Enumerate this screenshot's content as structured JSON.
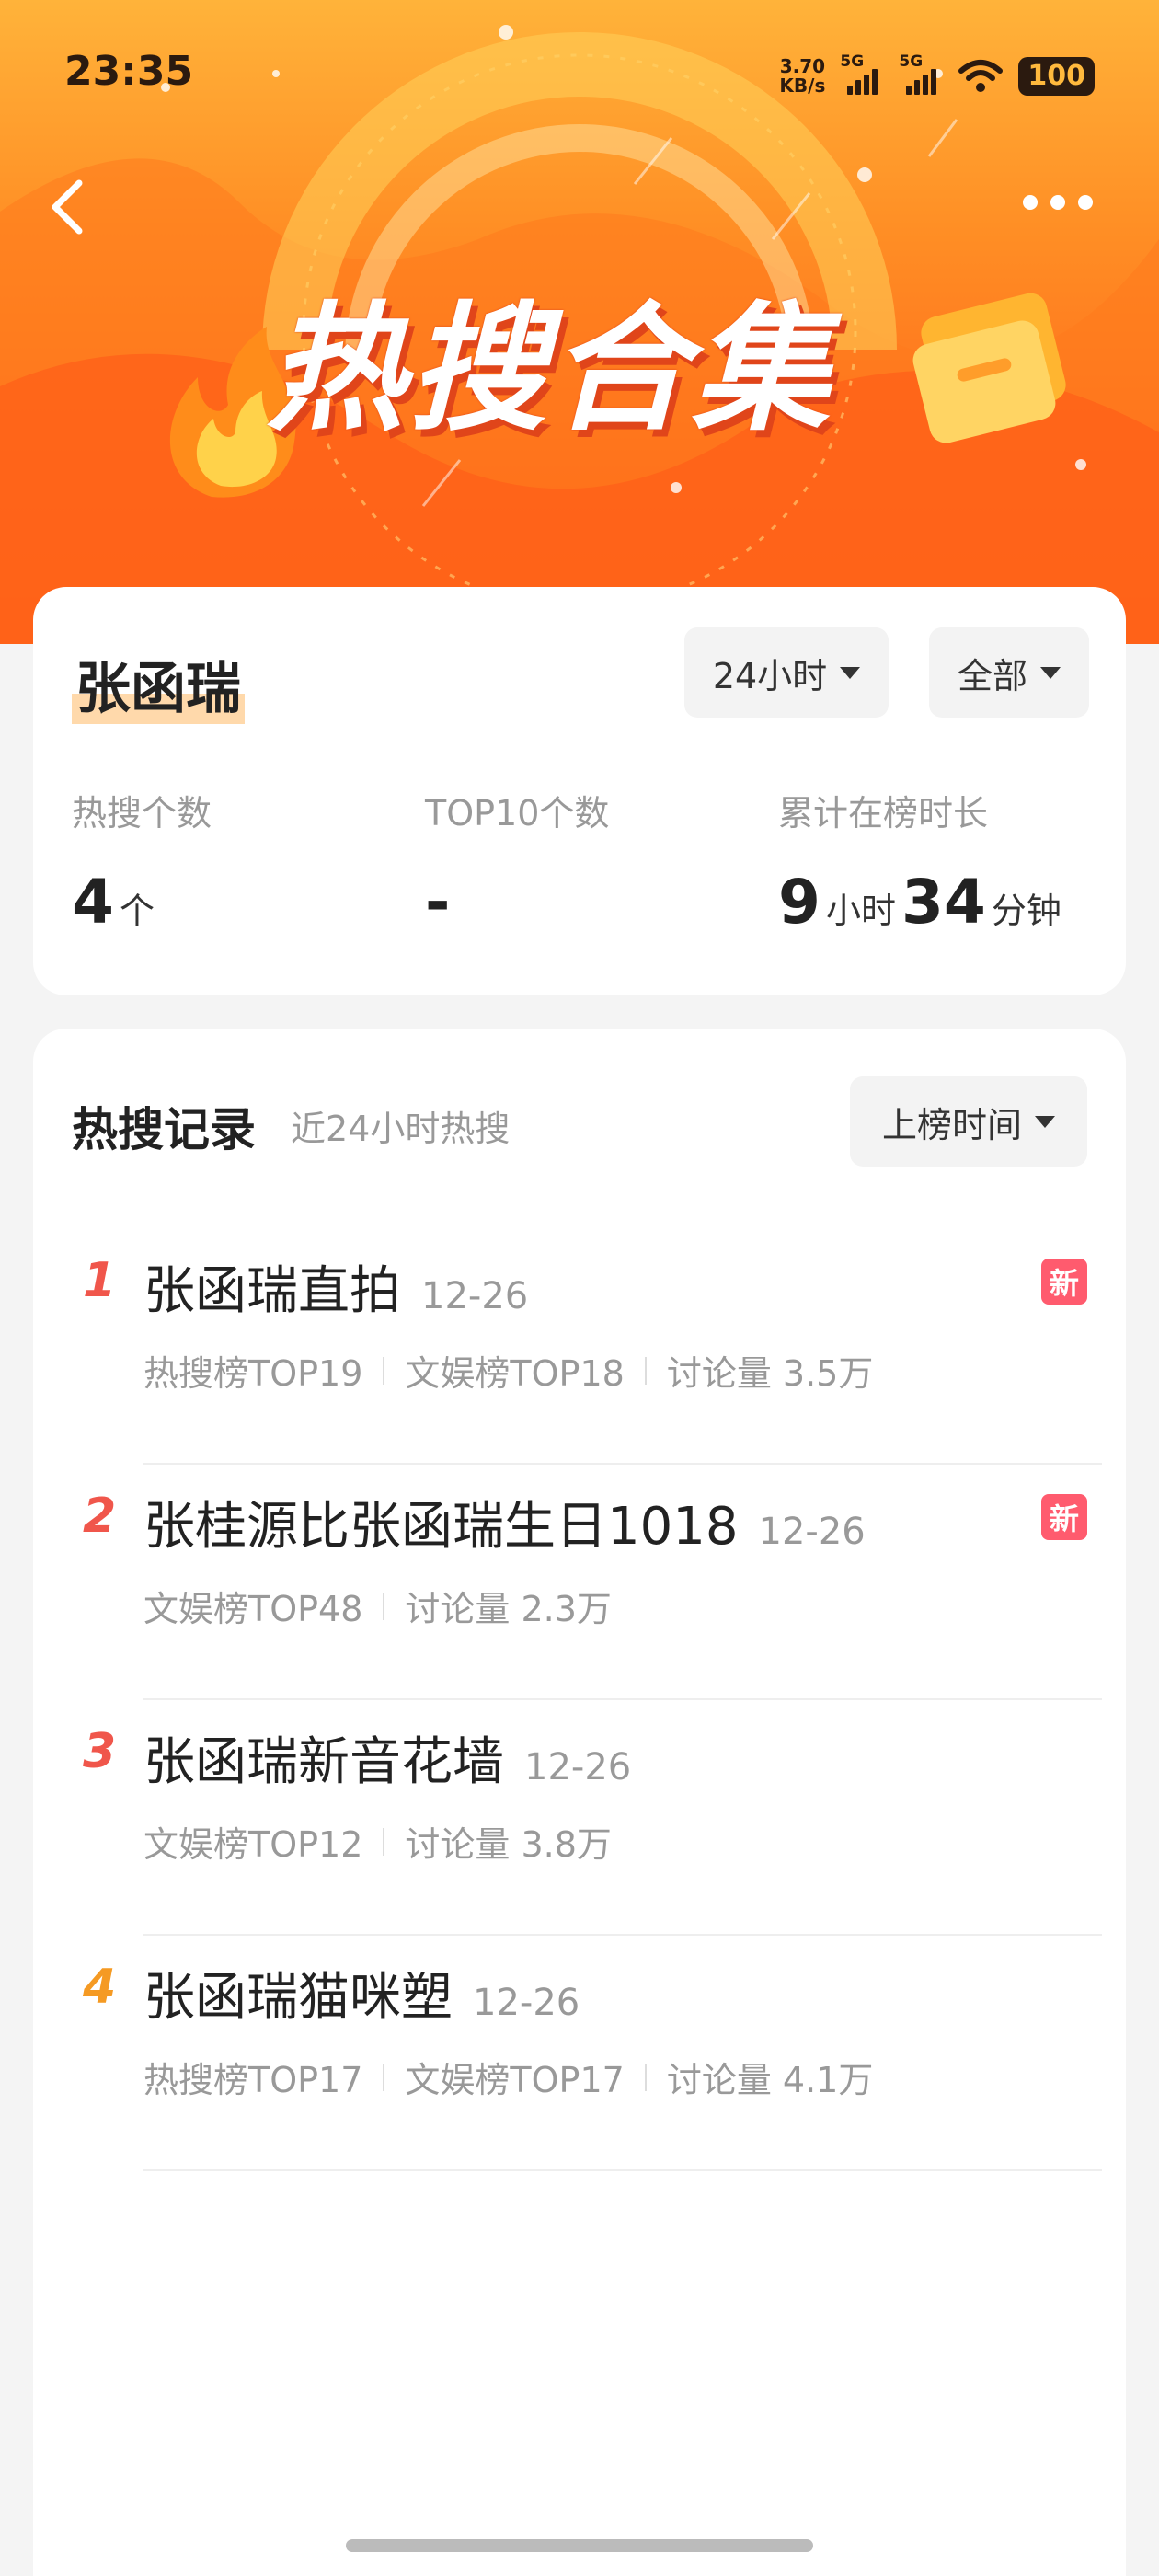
{
  "status_bar": {
    "time": "23:35",
    "net_speed_value": "3.70",
    "net_speed_unit": "KB/s",
    "signal1_label": "5G",
    "signal2_label": "5G",
    "battery": "100"
  },
  "header": {
    "banner_title": "热搜合集",
    "back_icon": "chevron-left-icon",
    "more_icon": "more-dots-icon",
    "colors": {
      "banner_top": "#ffb33a",
      "banner_bottom": "#ff5a17"
    }
  },
  "summary": {
    "topic": "张函瑞",
    "filter_time": "24小时",
    "filter_category": "全部",
    "stats": [
      {
        "label": "热搜个数",
        "value": "4",
        "unit": "个"
      },
      {
        "label": "TOP10个数",
        "value": "-"
      },
      {
        "label": "累计在榜时长",
        "hours": "9",
        "hours_unit": "小时",
        "minutes": "34",
        "minutes_unit": "分钟"
      }
    ]
  },
  "records": {
    "title": "热搜记录",
    "subtitle": "近24小时热搜",
    "sort_label": "上榜时间",
    "items": [
      {
        "rank": "1",
        "title": "张函瑞直拍",
        "date": "12-26",
        "meta": [
          "热搜榜TOP19",
          "文娱榜TOP18",
          "讨论量 3.5万"
        ],
        "badge": "新",
        "rank_color": "#f0564b"
      },
      {
        "rank": "2",
        "title": "张桂源比张函瑞生日1018",
        "date": "12-26",
        "meta": [
          "文娱榜TOP48",
          "讨论量 2.3万"
        ],
        "badge": "新",
        "rank_color": "#f0564b"
      },
      {
        "rank": "3",
        "title": "张函瑞新音花墙",
        "date": "12-26",
        "meta": [
          "文娱榜TOP12",
          "讨论量 3.8万"
        ],
        "badge": "",
        "rank_color": "#f0564b"
      },
      {
        "rank": "4",
        "title": "张函瑞猫咪塑",
        "date": "12-26",
        "meta": [
          "热搜榜TOP17",
          "文娱榜TOP17",
          "讨论量 4.1万"
        ],
        "badge": "",
        "rank_color": "#f59a23"
      }
    ]
  }
}
